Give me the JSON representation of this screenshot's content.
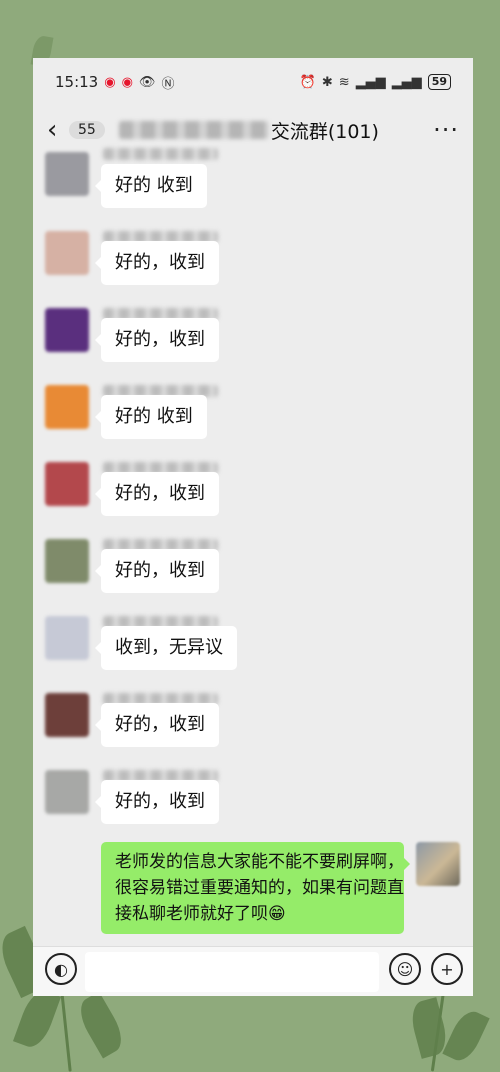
{
  "status_bar": {
    "time": "15:13",
    "left_icons": [
      "weibo-icon",
      "weibo-icon",
      "eye-icon",
      "nfc-icon"
    ],
    "right_icons": [
      "alarm-icon",
      "bluetooth-icon",
      "wifi-icon",
      "signal-icon",
      "signal-icon"
    ],
    "battery": "59"
  },
  "header": {
    "back_badge": "55",
    "title_visible": "交流群(101)",
    "more": "···"
  },
  "messages": [
    {
      "text": "好的  收到",
      "avatar_color": "#9a9aa0"
    },
    {
      "text": "好的，收到",
      "avatar_color": "#d6b1a4"
    },
    {
      "text": "好的，收到",
      "avatar_color": "#5a2f7e"
    },
    {
      "text": "好的  收到",
      "avatar_color": "#e88a35"
    },
    {
      "text": "好的，收到",
      "avatar_color": "#b3484c"
    },
    {
      "text": "好的，收到",
      "avatar_color": "#7f8b6a"
    },
    {
      "text": "收到，无异议",
      "avatar_color": "#c6c9d6"
    },
    {
      "text": "好的，收到",
      "avatar_color": "#6d3f3a"
    },
    {
      "text": "好的，收到",
      "avatar_color": "#a7a8a6"
    }
  ],
  "my_message": {
    "text": "老师发的信息大家能不能不要刷屏啊，很容易错过重要通知的，如果有问题直接私聊老师就好了呗😁"
  },
  "input_bar": {
    "voice_icon": "voice-icon",
    "emoji_icon": "emoji-icon",
    "plus_icon": "plus-icon"
  },
  "colors": {
    "background": "#8faa7c",
    "chat_bg": "#ededed",
    "my_bubble": "#95ec69",
    "other_bubble": "#ffffff"
  }
}
